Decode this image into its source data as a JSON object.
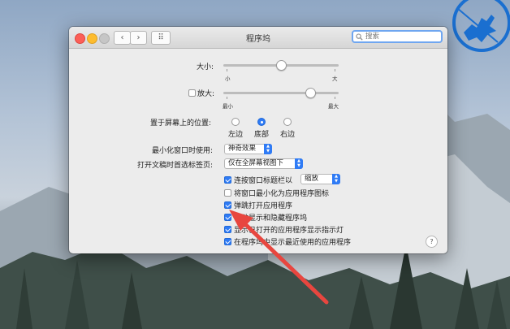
{
  "window": {
    "title": "程序坞",
    "nav_back": "‹",
    "nav_forward": "›",
    "grid_glyph": "⠿",
    "search_placeholder": "搜索"
  },
  "size": {
    "label": "大小:",
    "min_label": "小",
    "max_label": "大",
    "value": 0.5
  },
  "magnify": {
    "label": "放大:",
    "checked": false,
    "min_label": "最小",
    "max_label": "最大",
    "value": 0.75
  },
  "position": {
    "label": "置于屏幕上的位置:",
    "options": [
      {
        "label": "左边",
        "selected": false
      },
      {
        "label": "底部",
        "selected": true
      },
      {
        "label": "右边",
        "selected": false
      }
    ]
  },
  "minimize_effect": {
    "label": "最小化窗口时使用:",
    "value": "神奇效果"
  },
  "tabs_pref": {
    "label": "打开文稿时首选标签页:",
    "value": "仅在全屏幕视图下"
  },
  "checkboxes": [
    {
      "label": "连按窗口标题栏以",
      "checked": true,
      "popup": "缩放"
    },
    {
      "label": "将窗口最小化为应用程序图标",
      "checked": false
    },
    {
      "label": "弹跳打开应用程序",
      "checked": true
    },
    {
      "label": "自动显示和隐藏程序坞",
      "checked": true
    },
    {
      "label": "显示已打开的应用程序显示指示灯",
      "checked": true
    },
    {
      "label": "在程序坞中显示最近使用的应用程序",
      "checked": true
    }
  ],
  "help_label": "?",
  "colors": {
    "accent": "#2f7bf5",
    "arrow": "#e8463f",
    "logo": "#1a6fd0"
  },
  "icons": [
    "search-icon",
    "chevron-left-icon",
    "chevron-right-icon",
    "grid-icon",
    "help-icon",
    "knight-logo"
  ]
}
